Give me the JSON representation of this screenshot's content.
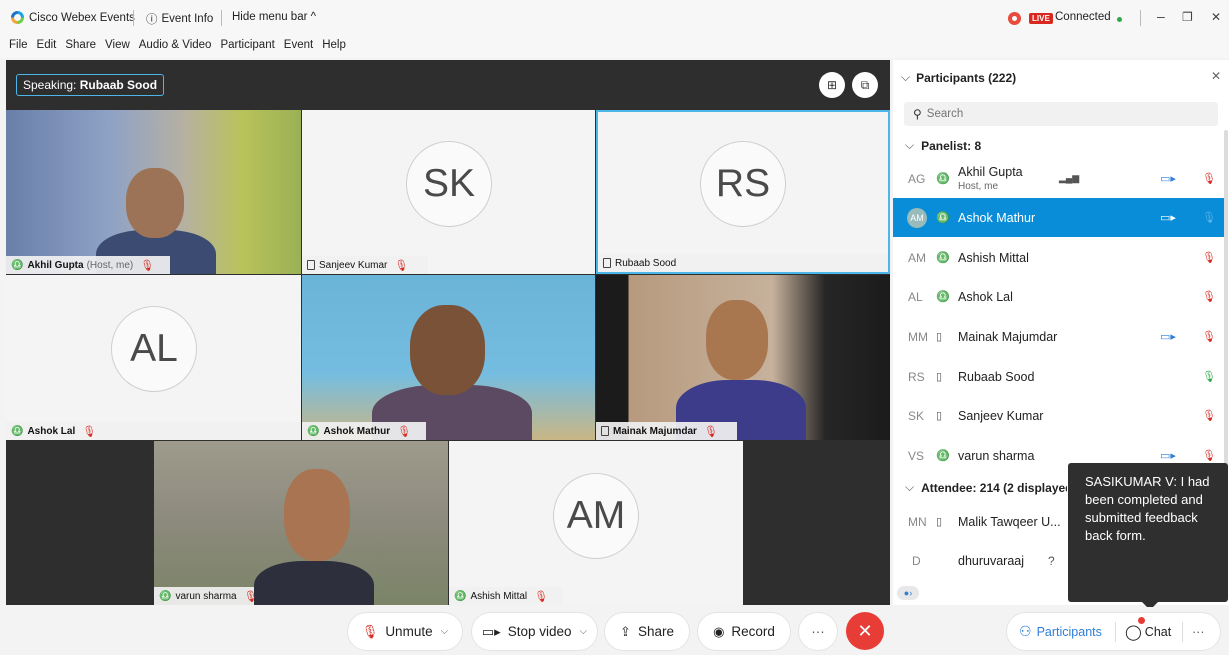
{
  "titlebar": {
    "app_name": "Cisco Webex Events",
    "event_info": "Event Info",
    "hide_menu": "Hide menu bar ^",
    "live": "LIVE",
    "connection": "Connected"
  },
  "menu": [
    "File",
    "Edit",
    "Share",
    "View",
    "Audio & Video",
    "Participant",
    "Event",
    "Help"
  ],
  "stage": {
    "speaking_prefix": "Speaking:",
    "speaking_name": "Rubaab Sood",
    "tiles": [
      {
        "name": "Akhil Gupta",
        "extra": "(Host, me)"
      },
      {
        "name": "Sanjeev Kumar",
        "initials": "SK"
      },
      {
        "name": "Rubaab Sood",
        "initials": "RS"
      },
      {
        "name": "Ashok Lal",
        "initials": "AL"
      },
      {
        "name": "Ashok Mathur"
      },
      {
        "name": "Mainak Majumdar"
      },
      {
        "name": "varun sharma"
      },
      {
        "name": "Ashish Mittal",
        "initials": "AM"
      }
    ]
  },
  "panel": {
    "title": "Participants (222)",
    "search_placeholder": "Search",
    "panelist_header": "Panelist: 8",
    "attendee_header": "Attendee: 214 (2 displayed)",
    "panelists": [
      {
        "initials": "AG",
        "name": "Akhil Gupta",
        "sub": "Host, me"
      },
      {
        "initials": "AM",
        "name": "Ashok Mathur"
      },
      {
        "initials": "AM",
        "name": "Ashish Mittal"
      },
      {
        "initials": "AL",
        "name": "Ashok Lal"
      },
      {
        "initials": "MM",
        "name": "Mainak Majumdar"
      },
      {
        "initials": "RS",
        "name": "Rubaab Sood"
      },
      {
        "initials": "SK",
        "name": "Sanjeev Kumar"
      },
      {
        "initials": "VS",
        "name": "varun sharma"
      }
    ],
    "attendees": [
      {
        "initials": "MN",
        "name": "Malik Tawqeer U..."
      },
      {
        "initials": "D",
        "name": "dhuruvaraaj",
        "extra": "?"
      }
    ]
  },
  "tooltip": "SASIKUMAR V: I had been completed and submitted feedback back form.",
  "toolbar": {
    "unmute": "Unmute",
    "stop_video": "Stop video",
    "share": "Share",
    "record": "Record",
    "more": "···",
    "participants": "Participants",
    "chat": "Chat"
  },
  "colors": {
    "accent": "#0a8dd9",
    "end_call": "#e83d36",
    "mic_muted": "#d9281f",
    "active_border": "#4db6e8"
  }
}
